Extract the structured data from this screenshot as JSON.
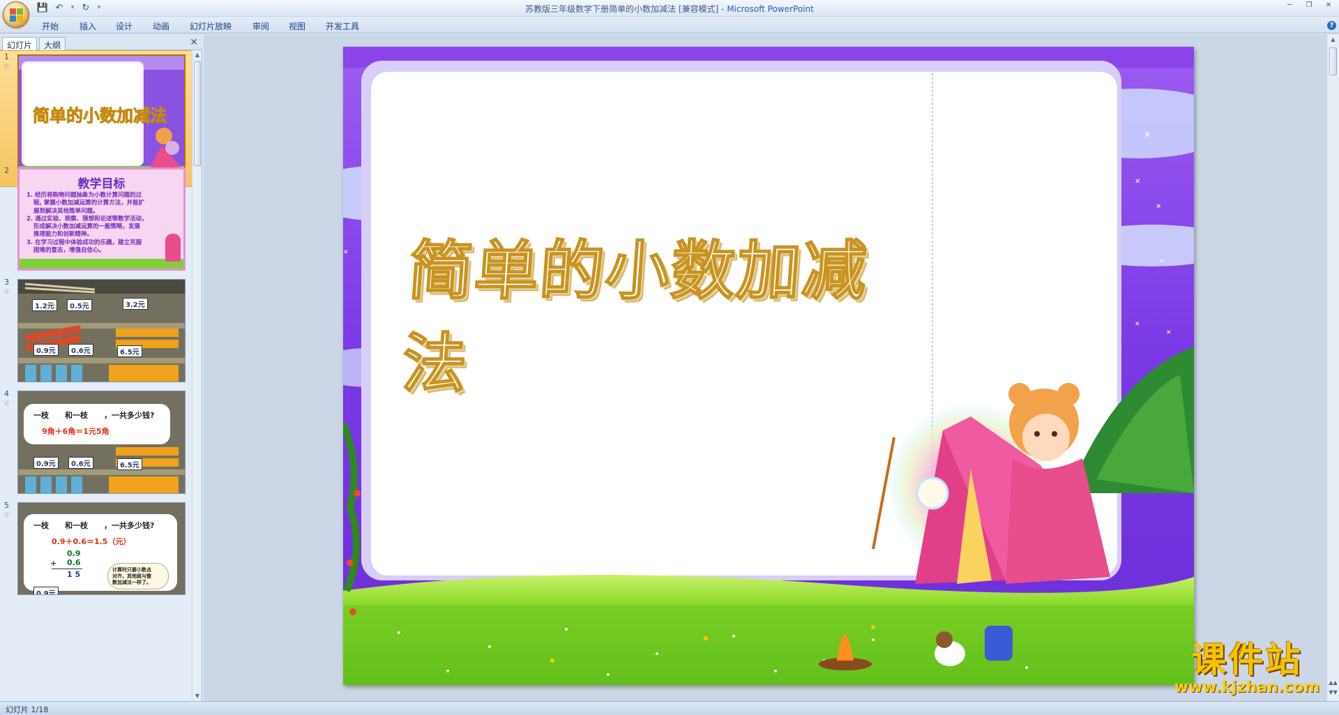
{
  "window": {
    "document_title": "苏教版三年级数学下册简单的小数加减法 [兼容模式]",
    "title_separator": " - ",
    "app_name": "Microsoft PowerPoint"
  },
  "quick_access": {
    "save_icon": "save-icon",
    "undo_icon": "undo-icon",
    "redo_icon": "redo-icon",
    "customize_icon": "chevron-down-icon"
  },
  "ribbon": {
    "tabs": [
      "开始",
      "插入",
      "设计",
      "动画",
      "幻灯片放映",
      "审阅",
      "视图",
      "开发工具"
    ]
  },
  "left_pane": {
    "tabs": [
      "幻灯片",
      "大纲"
    ],
    "close_label": "✕",
    "slide_numbers": [
      "1",
      "2",
      "3",
      "4",
      "5"
    ],
    "thumb2": {
      "title": "教学目标",
      "lines": [
        "1. 经历将购物问题抽象为小数计算问题的过",
        "程, 掌握小数加减运算的计算方法，并能扩",
        "展到解决其他简单问题。",
        "2. 通过实验、观察、猜想和论述等数学活动，",
        "形成解决小数加减运算的一般策略，发展",
        "推理能力和创新精神。",
        "3. 在学习过程中体验成功的乐趣，建立克服",
        "困难的意志，增强自信心。"
      ]
    },
    "thumb3": {
      "prices_top": [
        "1.2元",
        "0.5元",
        "3.2元"
      ],
      "prices_bottom": [
        "0.9元",
        "0.6元",
        "6.5元"
      ]
    },
    "thumb4": {
      "question": "一枝      和一枝      ，一共多少钱?",
      "answer": "9角＋6角＝1元5角",
      "prices_bottom": [
        "0.9元",
        "0.6元",
        "6.5元"
      ]
    },
    "thumb5": {
      "question": "一枝      和一枝      ，一共多少钱?",
      "equation": "0.9＋0.6＝1.5（元）",
      "vertical_top": "0.9",
      "vertical_plus": "+",
      "vertical_second": "0.6",
      "vertical_result": "1 5",
      "note_lines": [
        "计算时只要小数点",
        "对齐，其他就与整",
        "数加减法一样了。"
      ],
      "price_bottom": "0.9元"
    }
  },
  "slide": {
    "title": "简单的小数加减法"
  },
  "status_bar": {
    "slide_indicator": "幻灯片 1/18"
  },
  "watermark": {
    "brand": "课件站",
    "url": "www.kjzhan.com"
  }
}
